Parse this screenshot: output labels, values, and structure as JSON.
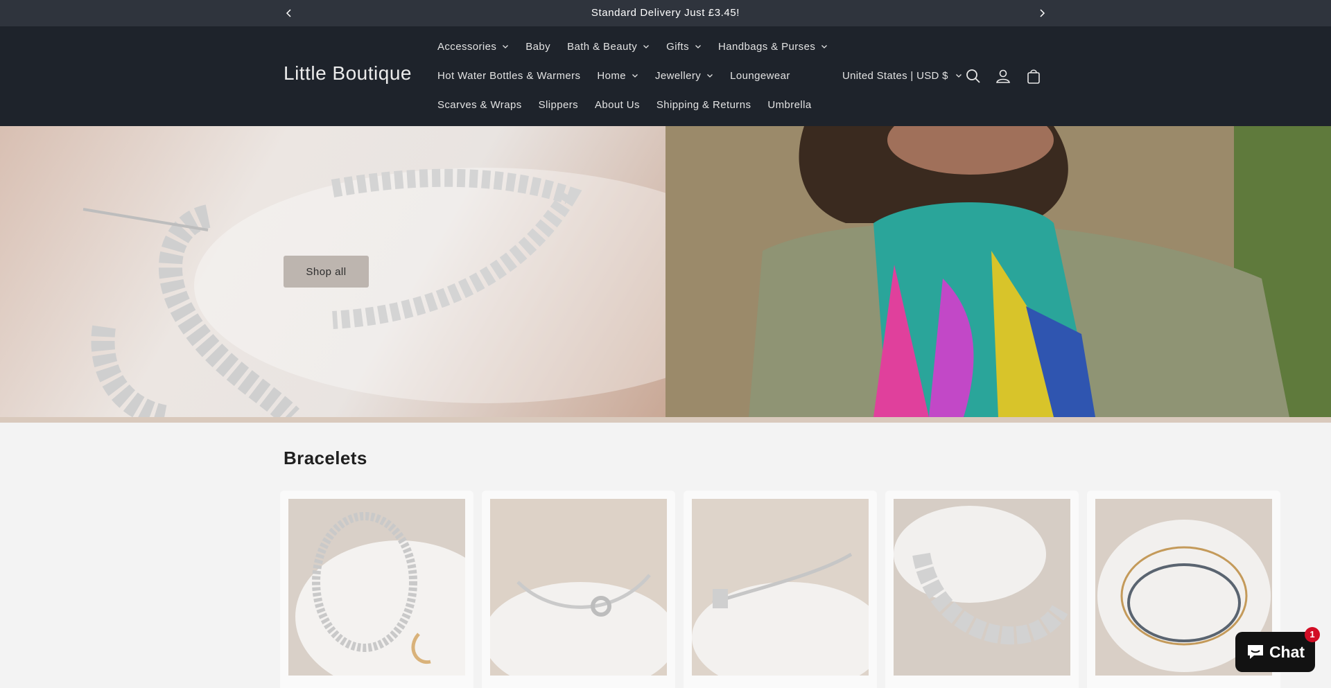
{
  "announcement": {
    "text": "Standard Delivery Just £3.45!",
    "prev_icon": "chevron-left-icon",
    "next_icon": "chevron-right-icon"
  },
  "header": {
    "logo": "Little Boutique",
    "nav_rows": [
      [
        {
          "label": "Accessories",
          "dropdown": true
        },
        {
          "label": "Baby",
          "dropdown": false
        },
        {
          "label": "Bath & Beauty",
          "dropdown": true
        },
        {
          "label": "Gifts",
          "dropdown": true
        },
        {
          "label": "Handbags & Purses",
          "dropdown": true
        }
      ],
      [
        {
          "label": "Hot Water Bottles & Warmers",
          "dropdown": false
        },
        {
          "label": "Home",
          "dropdown": true
        },
        {
          "label": "Jewellery",
          "dropdown": true
        },
        {
          "label": "Loungewear",
          "dropdown": false
        }
      ],
      [
        {
          "label": "Scarves & Wraps",
          "dropdown": false
        },
        {
          "label": "Slippers",
          "dropdown": false
        },
        {
          "label": "About Us",
          "dropdown": false
        },
        {
          "label": "Shipping & Returns",
          "dropdown": false
        },
        {
          "label": "Umbrella",
          "dropdown": false
        }
      ]
    ],
    "country_selector": "United States | USD $",
    "icons": [
      "search-icon",
      "account-icon",
      "cart-icon"
    ]
  },
  "hero": {
    "button_label": "Shop all"
  },
  "collection": {
    "title": "Bracelets",
    "products": [
      {
        "image": "silver bead bracelet with moon and star charm"
      },
      {
        "image": "silver bangle with crystal rondelle"
      },
      {
        "image": "silver bracelet with crystal cross charm"
      },
      {
        "image": "silver puffed heart bracelet"
      },
      {
        "image": "layered gold chain bracelet set"
      }
    ]
  },
  "chat": {
    "label": "Chat",
    "badge": "1"
  },
  "colors": {
    "announcement_bg": "#2f343d",
    "header_bg": "#1e232b",
    "page_bg": "#f3f3f3",
    "chat_badge": "#d20d25"
  }
}
